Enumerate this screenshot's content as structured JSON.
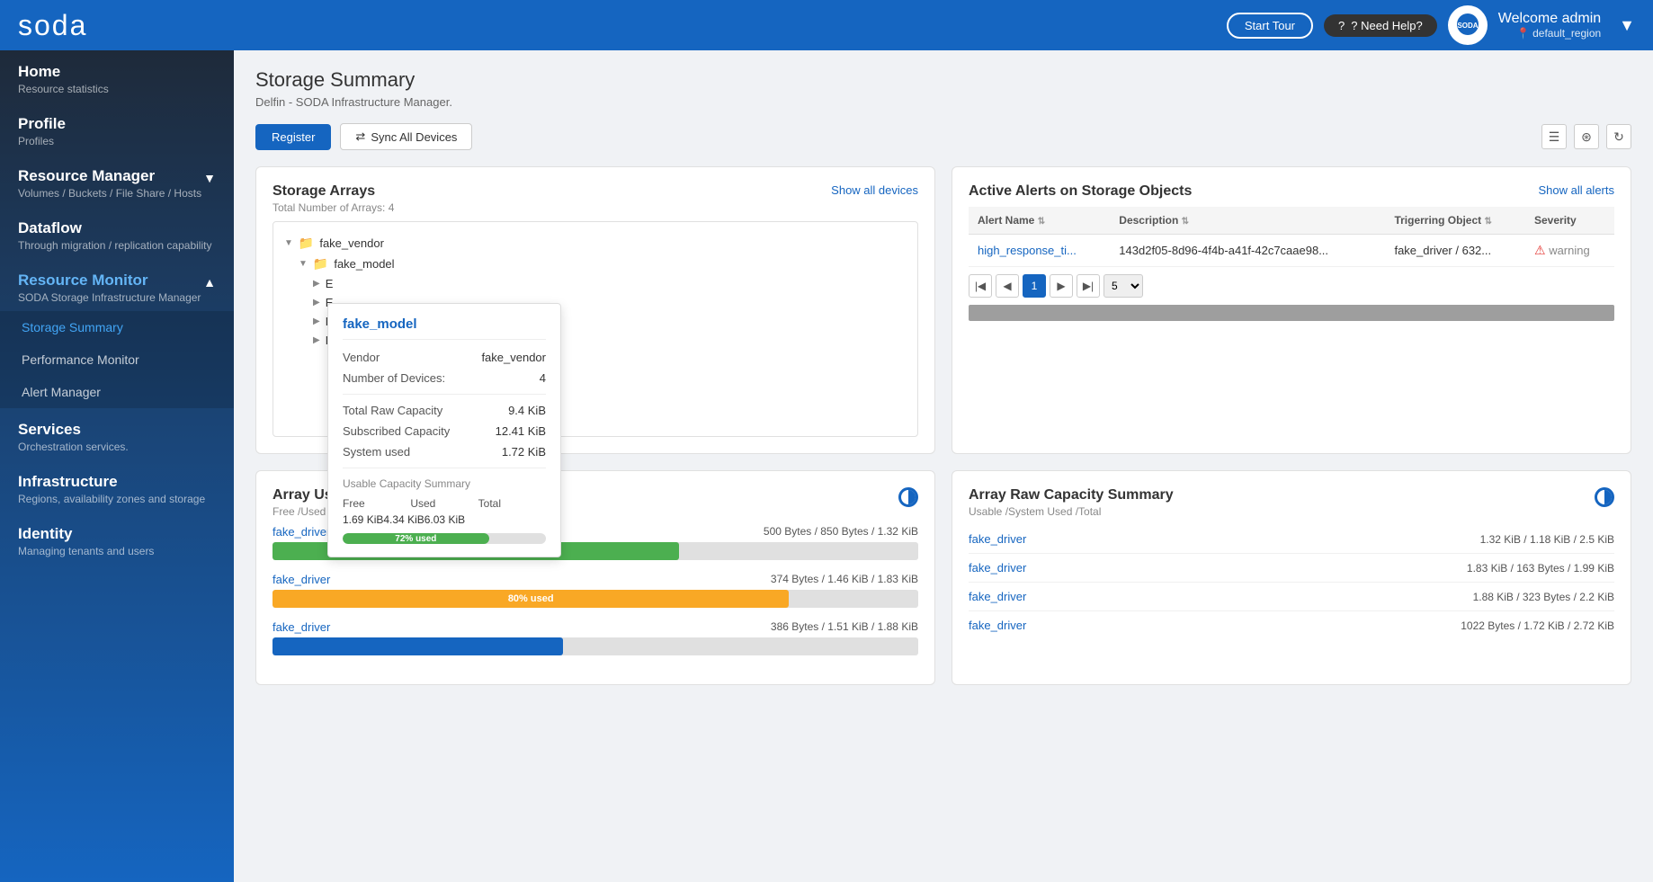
{
  "header": {
    "logo": "soda",
    "start_tour_label": "Start Tour",
    "need_help_label": "? Need Help?",
    "user_greeting": "Welcome admin",
    "user_region": "default_region",
    "soda_brand": "SODA"
  },
  "sidebar": {
    "items": [
      {
        "id": "home",
        "title": "Home",
        "sub": "Resource statistics",
        "active": false
      },
      {
        "id": "profile",
        "title": "Profile",
        "sub": "Profiles",
        "active": false
      },
      {
        "id": "resource-manager",
        "title": "Resource Manager",
        "sub": "Volumes / Buckets / File Share / Hosts",
        "active": false,
        "expandable": true,
        "expanded": true
      },
      {
        "id": "dataflow",
        "title": "Dataflow",
        "sub": "Through migration / replication capability",
        "active": false
      },
      {
        "id": "resource-monitor",
        "title": "Resource Monitor",
        "sub": "SODA Storage Infrastructure Manager",
        "active": true,
        "expandable": true,
        "expanded": true
      },
      {
        "id": "services",
        "title": "Services",
        "sub": "Orchestration services.",
        "active": false
      },
      {
        "id": "infrastructure",
        "title": "Infrastructure",
        "sub": "Regions, availability zones and storage",
        "active": false
      },
      {
        "id": "identity",
        "title": "Identity",
        "sub": "Managing tenants and users",
        "active": false
      }
    ],
    "sub_items_resource_monitor": [
      {
        "id": "storage-summary",
        "label": "Storage Summary",
        "active": true
      },
      {
        "id": "performance-monitor",
        "label": "Performance Monitor",
        "active": false
      },
      {
        "id": "alert-manager",
        "label": "Alert Manager",
        "active": false
      }
    ]
  },
  "main": {
    "page_title": "Storage Summary",
    "page_subtitle": "Delfin - SODA Infrastructure Manager.",
    "toolbar": {
      "register_label": "Register",
      "sync_label": "Sync All Devices"
    },
    "storage_arrays": {
      "title": "Storage Arrays",
      "subtitle": "Total Number of Arrays: 4",
      "show_all_label": "Show all devices",
      "tree": [
        {
          "level": 0,
          "label": "fake_vendor",
          "type": "folder",
          "expanded": true
        },
        {
          "level": 1,
          "label": "fake_model",
          "type": "folder",
          "expanded": true
        },
        {
          "level": 2,
          "label": "E",
          "type": "item"
        },
        {
          "level": 2,
          "label": "E",
          "type": "item"
        },
        {
          "level": 2,
          "label": "E",
          "type": "item"
        },
        {
          "level": 2,
          "label": "E",
          "type": "item"
        }
      ],
      "tooltip": {
        "title": "fake_model",
        "vendor_label": "Vendor",
        "vendor_value": "fake_vendor",
        "devices_label": "Number of Devices:",
        "devices_value": "4",
        "total_raw_label": "Total Raw Capacity",
        "total_raw_value": "9.4 KiB",
        "subscribed_label": "Subscribed Capacity",
        "subscribed_value": "12.41 KiB",
        "system_used_label": "System used",
        "system_used_value": "1.72 KiB",
        "usable_summary_title": "Usable Capacity Summary",
        "free_label": "Free",
        "free_value": "1.69 KiB",
        "used_label": "Used",
        "used_value": "4.34 KiB",
        "total_label": "Total",
        "total_value": "6.03 KiB",
        "progress_percent": 72,
        "progress_label": "72% used"
      }
    },
    "active_alerts": {
      "title": "Active Alerts on Storage Objects",
      "show_all_label": "Show all alerts",
      "columns": [
        {
          "label": "Alert Name",
          "sortable": true
        },
        {
          "label": "Description",
          "sortable": true
        },
        {
          "label": "Trigerring Object",
          "sortable": true
        },
        {
          "label": "Severity",
          "sortable": false
        }
      ],
      "rows": [
        {
          "alert_name": "high_response_ti...",
          "description": "143d2f05-8d96-4f4b-a41f-42c7caae98...",
          "triggering_object": "fake_driver / 632...",
          "severity_icon": "!",
          "severity": "warning"
        }
      ],
      "pagination": {
        "current_page": 1,
        "per_page": 5
      }
    },
    "array_usable_capacity": {
      "title": "Array Usable Capacity Summary",
      "subtitle": "Free /Used /Total",
      "rows": [
        {
          "driver": "fake_driver",
          "values": "500 Bytes / 850 Bytes / 1.32 KiB",
          "percent": 63,
          "percent_label": "63% used",
          "color": "green"
        },
        {
          "driver": "fake_driver",
          "values": "374 Bytes / 1.46 KiB / 1.83 KiB",
          "percent": 80,
          "percent_label": "80% used",
          "color": "yellow"
        },
        {
          "driver": "fake_driver",
          "values": "386 Bytes / 1.51 KiB / 1.88 KiB",
          "percent": 45,
          "percent_label": "",
          "color": "blue"
        }
      ]
    },
    "array_raw_capacity": {
      "title": "Array Raw Capacity Summary",
      "subtitle": "Usable /System Used /Total",
      "rows": [
        {
          "driver": "fake_driver",
          "values": "1.32 KiB / 1.18 KiB / 2.5 KiB"
        },
        {
          "driver": "fake_driver",
          "values": "1.83 KiB / 163 Bytes / 1.99 KiB"
        },
        {
          "driver": "fake_driver",
          "values": "1.88 KiB / 323 Bytes / 2.2 KiB"
        },
        {
          "driver": "fake_driver",
          "values": "1022 Bytes / 1.72 KiB / 2.72 KiB"
        }
      ]
    }
  }
}
